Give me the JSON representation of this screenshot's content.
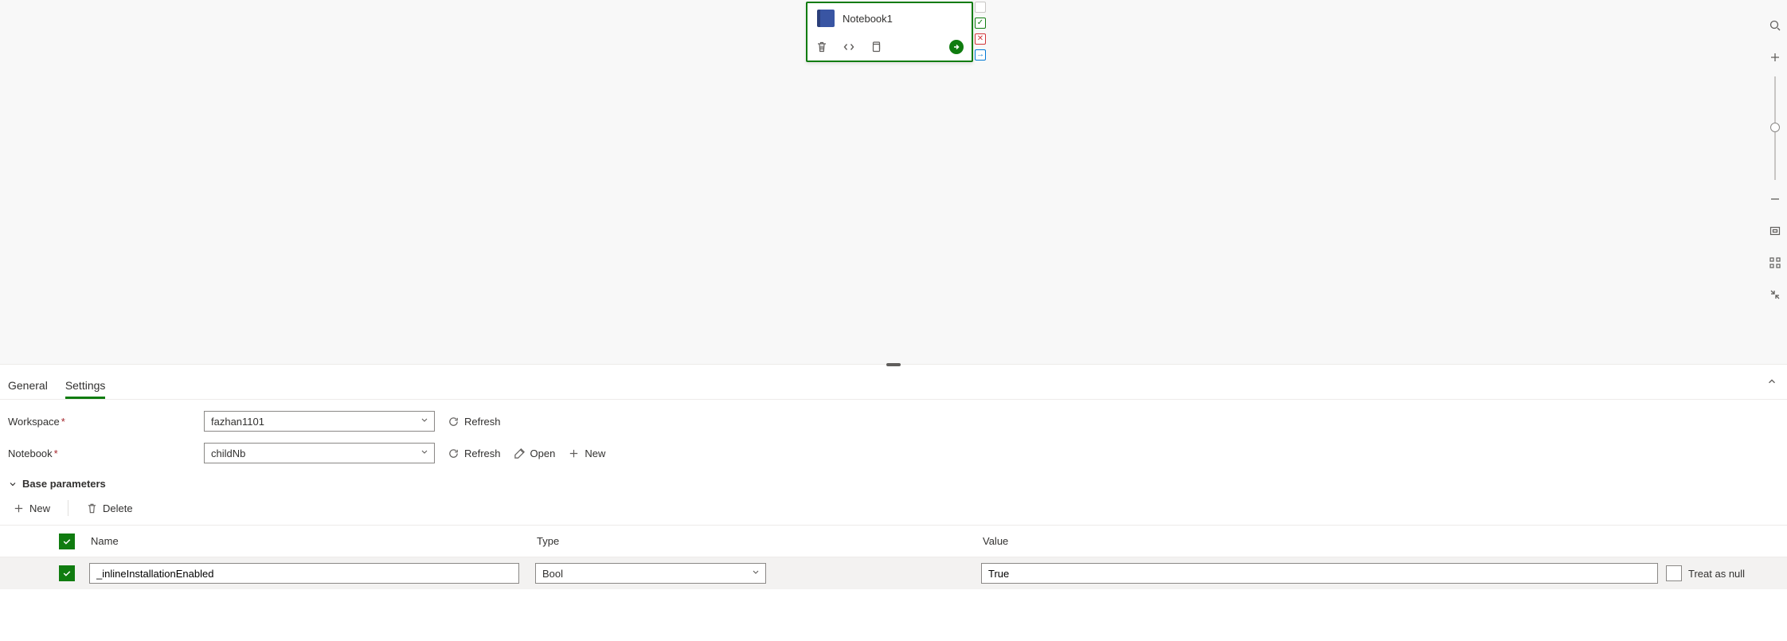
{
  "node": {
    "title": "Notebook1"
  },
  "tabs": {
    "general": "General",
    "settings": "Settings"
  },
  "fields": {
    "workspace_label": "Workspace",
    "workspace_value": "fazhan1101",
    "notebook_label": "Notebook",
    "notebook_value": "childNb",
    "refresh": "Refresh",
    "open": "Open",
    "new": "New"
  },
  "section": {
    "base_params": "Base parameters",
    "new": "New",
    "delete": "Delete"
  },
  "grid": {
    "headers": {
      "name": "Name",
      "type": "Type",
      "value": "Value"
    },
    "rows": [
      {
        "selected": true,
        "name": "_inlineInstallationEnabled",
        "type": "Bool",
        "value": "True",
        "treat_as_null_label": "Treat as null",
        "treat_as_null": false
      }
    ]
  }
}
